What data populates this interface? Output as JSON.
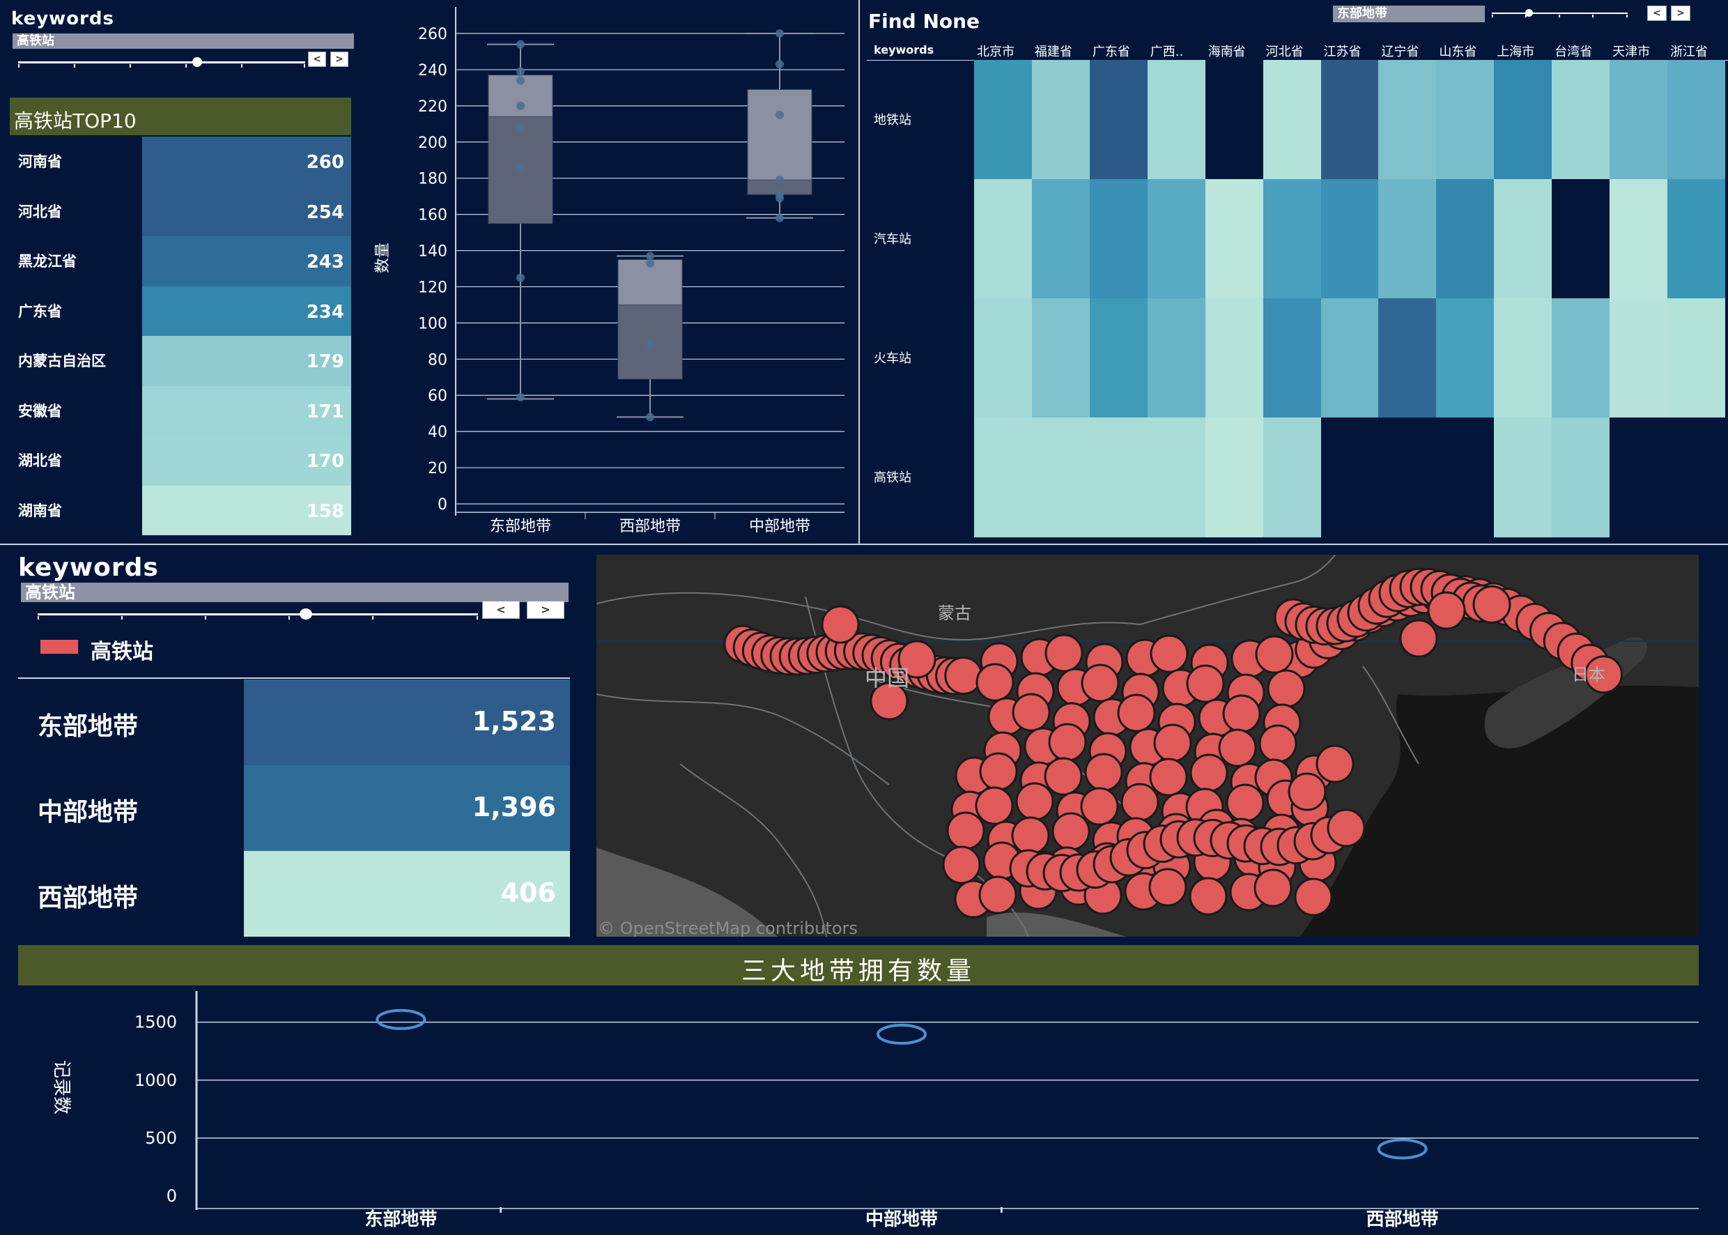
{
  "filter_top_left": {
    "title": "keywords",
    "value": "高铁站"
  },
  "top10": {
    "title": "高铁站TOP10",
    "rows": [
      {
        "name": "河南省",
        "value": "260",
        "color": "#2e5d8c"
      },
      {
        "name": "河北省",
        "value": "254",
        "color": "#2e5d8c"
      },
      {
        "name": "黑龙江省",
        "value": "243",
        "color": "#2f6d99"
      },
      {
        "name": "广东省",
        "value": "234",
        "color": "#3387ad"
      },
      {
        "name": "内蒙古自治区",
        "value": "179",
        "color": "#8fcbd1"
      },
      {
        "name": "安徽省",
        "value": "171",
        "color": "#9ed6d7"
      },
      {
        "name": "湖北省",
        "value": "170",
        "color": "#9fd6d6"
      },
      {
        "name": "湖南省",
        "value": "158",
        "color": "#bde6db"
      }
    ]
  },
  "boxplot": {
    "ylabel": "数量",
    "yticks": [
      "0",
      "20",
      "40",
      "60",
      "80",
      "100",
      "120",
      "140",
      "160",
      "180",
      "200",
      "220",
      "240",
      "260"
    ],
    "ymax": 270,
    "boxes": [
      {
        "label": "东部地带",
        "min": 58,
        "q1": 155,
        "median": 214,
        "q3": 237,
        "max": 254,
        "points": [
          254,
          239,
          234,
          220,
          208,
          186,
          125,
          59
        ]
      },
      {
        "label": "西部地带",
        "min": 48,
        "q1": 69,
        "median": 110,
        "q3": 135,
        "max": 137,
        "points": [
          137,
          133,
          88,
          48
        ]
      },
      {
        "label": "中部地带",
        "min": 158,
        "q1": 171,
        "median": 179,
        "q3": 229,
        "max": 260,
        "points": [
          260,
          243,
          215,
          179,
          171,
          169,
          158
        ]
      }
    ]
  },
  "heatmap": {
    "title": "Find None",
    "filter_value": "东部地带",
    "corner_label": "keywords",
    "columns": [
      "北京市",
      "福建省",
      "广东省",
      "广西..",
      "海南省",
      "河北省",
      "江苏省",
      "辽宁省",
      "山东省",
      "上海市",
      "台湾省",
      "天津市",
      "浙江省"
    ],
    "rows": [
      "地铁站",
      "汽车站",
      "火车站",
      "高铁站"
    ],
    "colors": [
      [
        "#3a98b5",
        "#8fcbd1",
        "#2b5a88",
        "#a2d9d6",
        "#03163a",
        "#b3e2d9",
        "#2e5a88",
        "#7fc1cd",
        "#78bdcb",
        "#3189b0",
        "#9dd5d5",
        "#6bb6c8",
        "#5fadc5"
      ],
      [
        "#aadcd7",
        "#5aa9c2",
        "#3a8fb5",
        "#5aaac3",
        "#bde6db",
        "#49a1bf",
        "#3a90b5",
        "#6cb6c8",
        "#3586ad",
        "#a9dcd7",
        "#03163a",
        "#bae5da",
        "#3a97b6"
      ],
      [
        "#a2d9d6",
        "#7fc1cd",
        "#3e9bb8",
        "#68b4c7",
        "#b5e2d9",
        "#3a8fb4",
        "#6db7c8",
        "#2f6895",
        "#48a0bf",
        "#b0e0d8",
        "#77bdcb",
        "#b7e3da",
        "#b3e2d9"
      ],
      [
        "#a9dcd7",
        "#a9dcd7",
        "#a9dcd7",
        "#aadcd7",
        "#bde6db",
        "#9ed6d5",
        "#03163a",
        "#03163a",
        "#03163a",
        "#a5dad6",
        "#96d1d3",
        "#03163a",
        "#03163a"
      ]
    ]
  },
  "filter_bottom": {
    "title": "keywords",
    "value": "高铁站",
    "legend": "高铁站",
    "legend_color": "#e05a5a"
  },
  "zones": [
    {
      "name": "东部地带",
      "value": "1,523",
      "color": "#2e5d8c"
    },
    {
      "name": "中部地带",
      "value": "1,396",
      "color": "#2f6d99"
    },
    {
      "name": "西部地带",
      "value": "406",
      "color": "#bde6db"
    }
  ],
  "map": {
    "labels": {
      "mongolia": "蒙古",
      "china": "中国",
      "japan": "日本"
    },
    "attribution": "© OpenStreetMap contributors"
  },
  "bottom_chart": {
    "title": "三大地带拥有数量",
    "ylabel": "记录数",
    "yticks": [
      "0",
      "500",
      "1000",
      "1500"
    ]
  },
  "chart_data": [
    {
      "type": "table",
      "title": "高铁站TOP10",
      "categories": [
        "河南省",
        "河北省",
        "黑龙江省",
        "广东省",
        "内蒙古自治区",
        "安徽省",
        "湖北省",
        "湖南省"
      ],
      "values": [
        260,
        254,
        243,
        234,
        179,
        171,
        170,
        158
      ]
    },
    {
      "type": "scatter",
      "title": "",
      "xlabel": "",
      "ylabel": "数量",
      "categories": [
        "东部地带",
        "西部地带",
        "中部地带"
      ],
      "ylim": [
        0,
        270
      ],
      "series": [
        {
          "values": [
            [
              254,
              239,
              234,
              220,
              208,
              186,
              125,
              59
            ],
            [
              137,
              133,
              88,
              48
            ],
            [
              260,
              243,
              215,
              179,
              171,
              169,
              158
            ]
          ]
        }
      ]
    },
    {
      "type": "heatmap",
      "title": "Find None",
      "x": [
        "北京市",
        "福建省",
        "广东省",
        "广西..",
        "海南省",
        "河北省",
        "江苏省",
        "辽宁省",
        "山东省",
        "上海市",
        "台湾省",
        "天津市",
        "浙江省"
      ],
      "y": [
        "地铁站",
        "汽车站",
        "火车站",
        "高铁站"
      ]
    },
    {
      "type": "table",
      "categories": [
        "东部地带",
        "中部地带",
        "西部地带"
      ],
      "values": [
        1523,
        1396,
        406
      ]
    },
    {
      "type": "scatter",
      "title": "三大地带拥有数量",
      "ylabel": "记录数",
      "categories": [
        "东部地带",
        "中部地带",
        "西部地带"
      ],
      "values": [
        1523,
        1396,
        406
      ],
      "ylim": [
        0,
        1600
      ],
      "grid": true
    }
  ]
}
